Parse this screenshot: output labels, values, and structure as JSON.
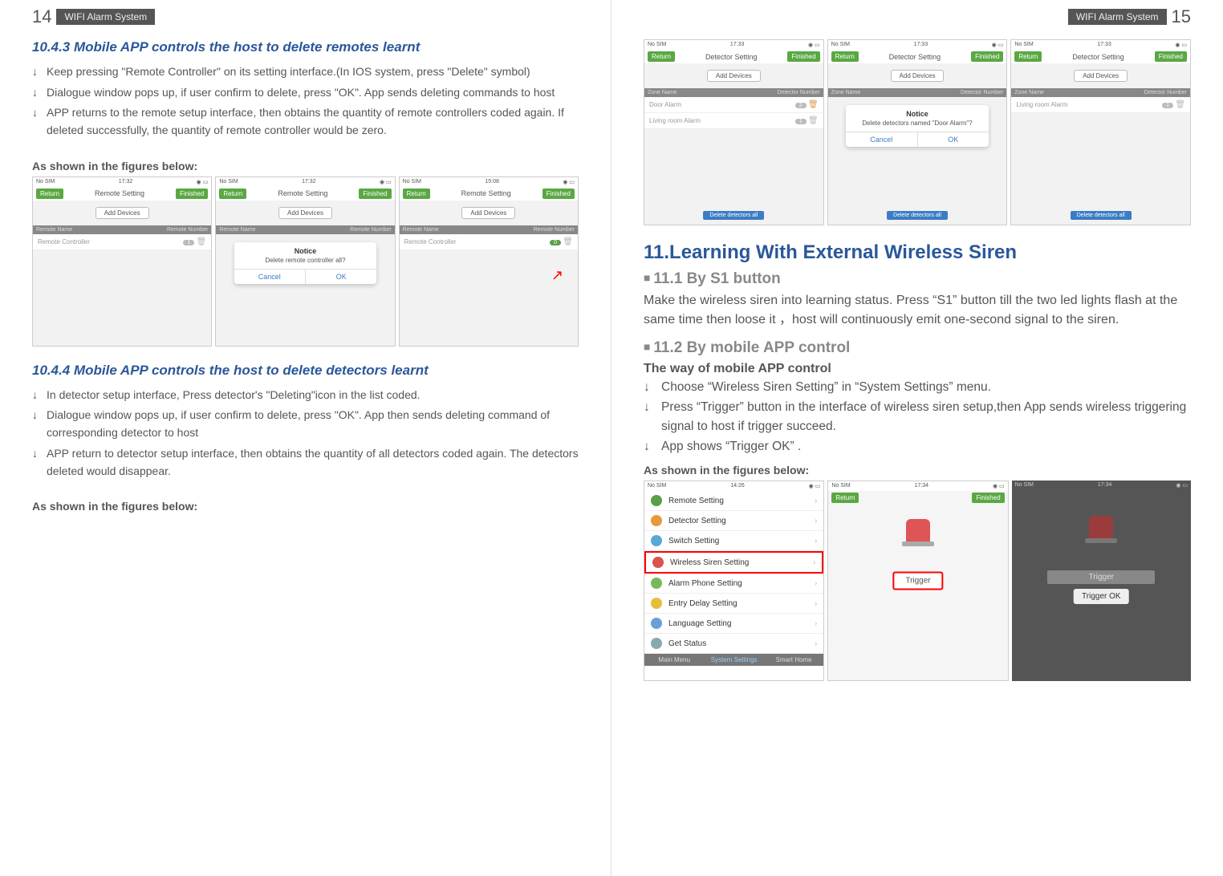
{
  "left_page": {
    "page_number": "14",
    "header_label": "WIFI Alarm System",
    "section_10_4_3": {
      "title": "10.4.3 Mobile APP controls the host to delete remotes learnt",
      "bullets": [
        "Keep pressing \"Remote Controller\" on its setting interface.(In IOS system, press \"Delete\" symbol)",
        "Dialogue window pops up, if user confirm to delete, press \"OK\". App sends deleting commands to host",
        "APP returns to the remote setup interface, then obtains the quantity of remote controllers coded again. If deleted successfully, the quantity of remote controller would be zero."
      ],
      "fig_label": "As shown in the figures below:",
      "screens": [
        {
          "carrier": "No SIM",
          "time": "17:32",
          "title": "Remote Setting",
          "return": "Return",
          "finished": "Finished",
          "add": "Add Devices",
          "lh_left": "Remote Name",
          "lh_right": "Remote Number",
          "row": "Remote Controller",
          "badge": "1"
        },
        {
          "carrier": "No SIM",
          "time": "17:32",
          "title": "Remote Setting",
          "return": "Return",
          "finished": "Finished",
          "add": "Add Devices",
          "lh_left": "Remote Name",
          "lh_right": "Remote Number",
          "notice_title": "Notice",
          "notice_sub": "Delete remote controller all?",
          "cancel": "Cancel",
          "ok": "OK"
        },
        {
          "carrier": "No SIM",
          "time": "15:08",
          "title": "Remote Setting",
          "return": "Return",
          "finished": "Finished",
          "add": "Add Devices",
          "lh_left": "Remote Name",
          "lh_right": "Remote Number",
          "row": "Remote Controller",
          "badge": "0"
        }
      ]
    },
    "section_10_4_4": {
      "title": "10.4.4 Mobile APP controls the host to delete detectors learnt",
      "bullets": [
        "In detector setup interface, Press detector's \"Deleting\"icon in the list coded.",
        "Dialogue window pops up, if user confirm to delete, press \"OK\". App then sends deleting command of corresponding detector to host",
        "APP return to detector setup interface, then obtains the quantity of all detectors coded again. The detectors deleted would disappear."
      ],
      "fig_label": "As shown in the figures below:"
    }
  },
  "right_page": {
    "page_number": "15",
    "header_label": "WIFI Alarm System",
    "top_screens": [
      {
        "carrier": "No SIM",
        "time": "17:33",
        "title": "Detector Setting",
        "return": "Return",
        "finished": "Finished",
        "add": "Add Devices",
        "lh_left": "Zone Name",
        "lh_right": "Detector Number",
        "row1": "Door Alarm",
        "badge1": "2",
        "row2": "Living room Alarm",
        "badge2": "1"
      },
      {
        "carrier": "No SIM",
        "time": "17:33",
        "title": "Detector Setting",
        "return": "Return",
        "finished": "Finished",
        "add": "Add Devices",
        "lh_left": "Zone Name",
        "lh_right": "Detector Number",
        "notice_title": "Notice",
        "notice_sub": "Delete detectors named \"Door Alarm\"?",
        "cancel": "Cancel",
        "ok": "OK"
      },
      {
        "carrier": "No SIM",
        "time": "17:33",
        "title": "Detector Setting",
        "return": "Return",
        "finished": "Finished",
        "add": "Add Devices",
        "lh_left": "Zone Name",
        "lh_right": "Detector Number",
        "row": "Living room Alarm",
        "badge": "1"
      }
    ],
    "h1": "11.Learning With External Wireless Siren",
    "sec_11_1": {
      "title": "11.1 By S1 button",
      "body": "Make the wireless siren into learning status. Press “S1” button till the two led lights flash at the same time then loose it ，host will continuously emit one-second signal to the siren."
    },
    "sec_11_2": {
      "title": "11.2 By mobile APP control",
      "sub": "The way of mobile APP control",
      "bullets": [
        "Choose “Wireless Siren Setting” in “System Settings” menu.",
        "Press “Trigger” button in the interface of wireless siren setup,then App sends wireless triggering signal to host if trigger succeed.",
        "App shows “Trigger OK” ."
      ],
      "fig_label": "As shown in the figures below:",
      "settings_screen": {
        "carrier": "No SIM",
        "time": "14:26",
        "rows": [
          "Remote Setting",
          "Detector Setting",
          "Switch Setting",
          "Wireless Siren Setting",
          "Alarm Phone Setting",
          "Entry Delay Setting",
          "Language Setting",
          "Get Status"
        ],
        "row_colors": [
          "#5a9e4a",
          "#e69a3d",
          "#5aa8d6",
          "#d9534f",
          "#7ab85c",
          "#e6be3d",
          "#6aa0d6",
          "#8aa"
        ],
        "tabs": [
          "Main Menu",
          "System Settings",
          "Smart Home"
        ]
      },
      "trigger_screen": {
        "carrier": "No SIM",
        "time": "17:34",
        "return": "Return",
        "finished": "Finished",
        "trigger": "Trigger"
      },
      "dark_screen": {
        "carrier": "No SIM",
        "time": "17:34",
        "trigger": "Trigger",
        "popup": "Trigger OK"
      }
    }
  }
}
